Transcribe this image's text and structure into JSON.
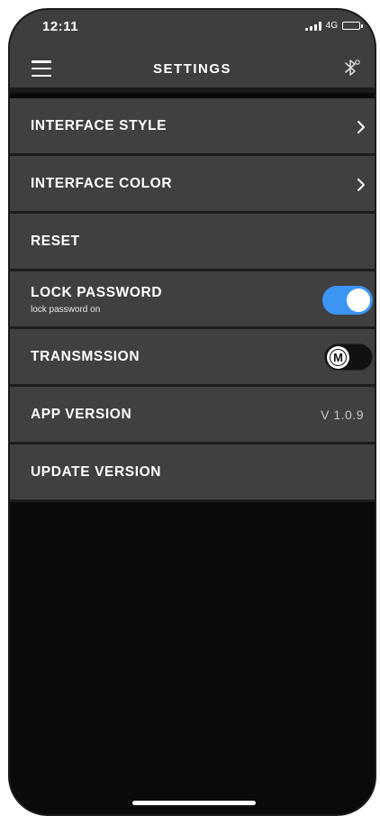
{
  "status_bar": {
    "time": "12:11",
    "network": "4G"
  },
  "header": {
    "title": "SETTINGS",
    "icons": {
      "menu": "menu-icon",
      "bluetooth": "bluetooth-icon"
    }
  },
  "settings": {
    "interface_style": {
      "label": "INTERFACE STYLE"
    },
    "interface_color": {
      "label": "INTERFACE COLOR"
    },
    "reset": {
      "label": "RESET"
    },
    "lock_password": {
      "label": "LOCK PASSWORD",
      "sublabel": "lock password on",
      "toggle_on": true
    },
    "transmission": {
      "label": "TRANSMSSION",
      "toggle_symbol": "M",
      "toggle_on": false
    },
    "app_version": {
      "label": "APP VERSION",
      "value": "V 1.0.9"
    },
    "update_version": {
      "label": "UPDATE VERSION"
    }
  },
  "colors": {
    "accent": "#3d95f3",
    "row_background": "#404040",
    "screen_background": "#0a0a0a"
  }
}
